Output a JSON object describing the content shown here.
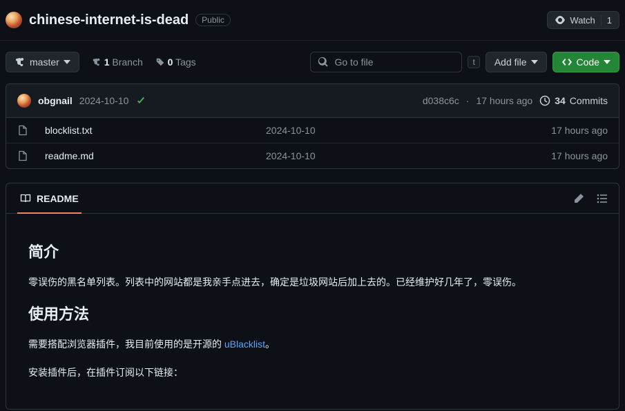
{
  "header": {
    "repo_name": "chinese-internet-is-dead",
    "visibility": "Public",
    "watch_label": "Watch",
    "watch_count": "1"
  },
  "toolbar": {
    "branch": "master",
    "branch_count": "1",
    "branch_label": "Branch",
    "tag_count": "0",
    "tag_label": "Tags",
    "search_placeholder": "Go to file",
    "search_key": "t",
    "add_file": "Add file",
    "code": "Code"
  },
  "commits": {
    "author": "obgnail",
    "message": "2024-10-10",
    "sha": "d038c6c",
    "time": "17 hours ago",
    "count": "34",
    "commits_label": "Commits"
  },
  "files": [
    {
      "name": "blocklist.txt",
      "msg": "2024-10-10",
      "time": "17 hours ago"
    },
    {
      "name": "readme.md",
      "msg": "2024-10-10",
      "time": "17 hours ago"
    }
  ],
  "readme": {
    "tab": "README",
    "h_intro": "简介",
    "p_intro": "零误伤的黑名单列表。列表中的网站都是我亲手点进去，确定是垃圾网站后加上去的。已经维护好几年了，零误伤。",
    "h_usage": "使用方法",
    "p_usage_pre": "需要搭配浏览器插件，我目前使用的是开源的 ",
    "p_usage_link": "uBlacklist",
    "p_usage_post": "。",
    "p_sub": "安装插件后，在插件订阅以下链接："
  }
}
